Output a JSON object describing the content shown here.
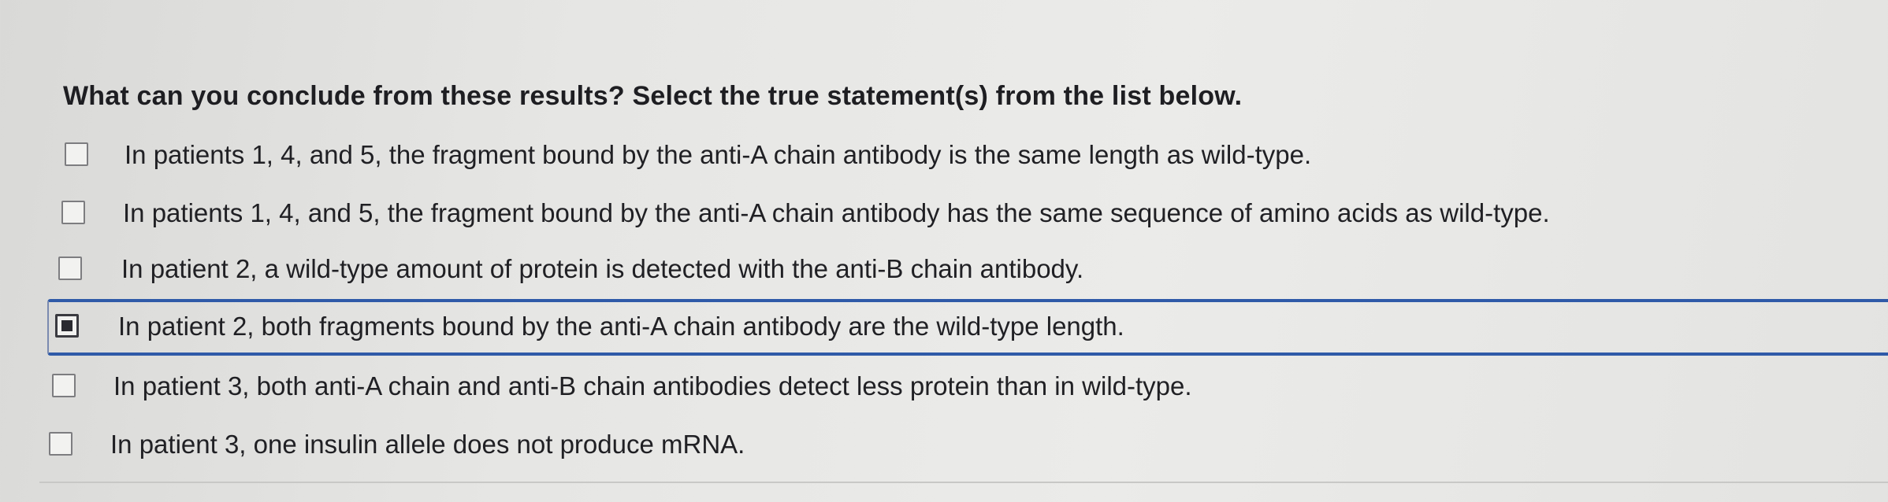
{
  "question": "What can you conclude from these results? Select the true statement(s) from the list below.",
  "options": [
    {
      "label": "In patients 1, 4, and 5, the fragment bound by the anti-A chain antibody is the same length as wild-type.",
      "checked": false
    },
    {
      "label": "In patients 1, 4, and 5, the fragment bound by the anti-A chain antibody has the same sequence of amino acids as wild-type.",
      "checked": false
    },
    {
      "label": "In patient 2, a wild-type amount of protein is detected with the anti-B chain antibody.",
      "checked": false
    },
    {
      "label": "In patient 2, both fragments bound by the anti-A chain antibody are the wild-type length.",
      "checked": true
    },
    {
      "label": "In patient 3, both anti-A chain and anti-B chain antibodies detect less protein than in wild-type.",
      "checked": false
    },
    {
      "label": "In patient 3, one insulin allele does not produce mRNA.",
      "checked": false
    }
  ]
}
